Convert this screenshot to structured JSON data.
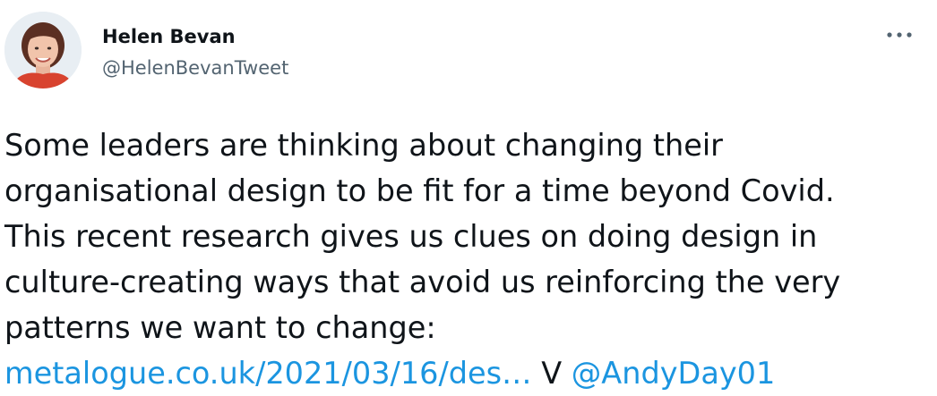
{
  "author": {
    "display_name": "Helen Bevan",
    "handle": "@HelenBevanTweet",
    "avatar_description": "profile photo"
  },
  "menu": {
    "icon": "more-dots-icon"
  },
  "tweet": {
    "lines": [
      "Some leaders are thinking about changing their",
      "organisational design to be fit for a time beyond Covid.",
      "This recent research gives us clues on doing design in",
      "culture-creating ways that avoid us reinforcing the very",
      "patterns we want to change:"
    ],
    "link_text": "metalogue.co.uk/2021/03/16/des…",
    "via_text": "V",
    "mention_text": "@AndyDay01"
  },
  "colors": {
    "text": "#0f1419",
    "secondary_text": "#536471",
    "link": "#1b95e0"
  }
}
